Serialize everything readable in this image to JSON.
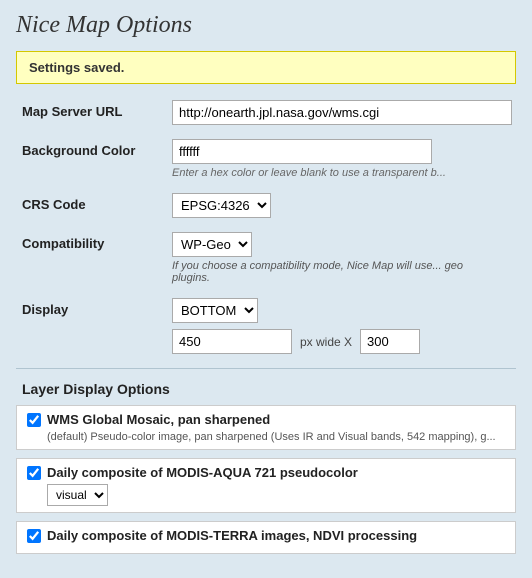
{
  "title": "Nice Map Options",
  "banner": {
    "text": "Settings saved."
  },
  "form": {
    "map_server_url": {
      "label": "Map Server URL",
      "value": "http://onearth.jpl.nasa.gov/wms.cgi"
    },
    "background_color": {
      "label": "Background Color",
      "value": "ffffff",
      "hint": "Enter a hex color or leave blank to use a transparent b..."
    },
    "crs_code": {
      "label": "CRS Code",
      "options": [
        "EPSG:4326"
      ],
      "selected": "EPSG:4326"
    },
    "compatibility": {
      "label": "Compatibility",
      "options": [
        "WP-Geo"
      ],
      "selected": "WP-Geo",
      "hint": "If you choose a compatibility mode, Nice Map will use... geo plugins."
    },
    "display": {
      "label": "Display",
      "options": [
        "BOTTOM"
      ],
      "selected": "BOTTOM",
      "width_value": "450",
      "width_label": "px wide X",
      "height_value": "300"
    }
  },
  "layer_display": {
    "title": "Layer Display Options",
    "layers": [
      {
        "id": "layer1",
        "checked": true,
        "title": "WMS Global Mosaic, pan sharpened",
        "desc": "(default) Pseudo-color image, pan sharpened (Uses IR and Visual bands, 542 mapping), g...",
        "has_select": false
      },
      {
        "id": "layer2",
        "checked": true,
        "title": "Daily composite of MODIS-AQUA 721 pseudocolor",
        "desc": "",
        "has_select": true,
        "select_options": [
          "visual"
        ],
        "select_value": "visual"
      },
      {
        "id": "layer3",
        "checked": true,
        "title": "Daily composite of MODIS-TERRA images, NDVI processing",
        "desc": "",
        "has_select": false
      }
    ]
  }
}
